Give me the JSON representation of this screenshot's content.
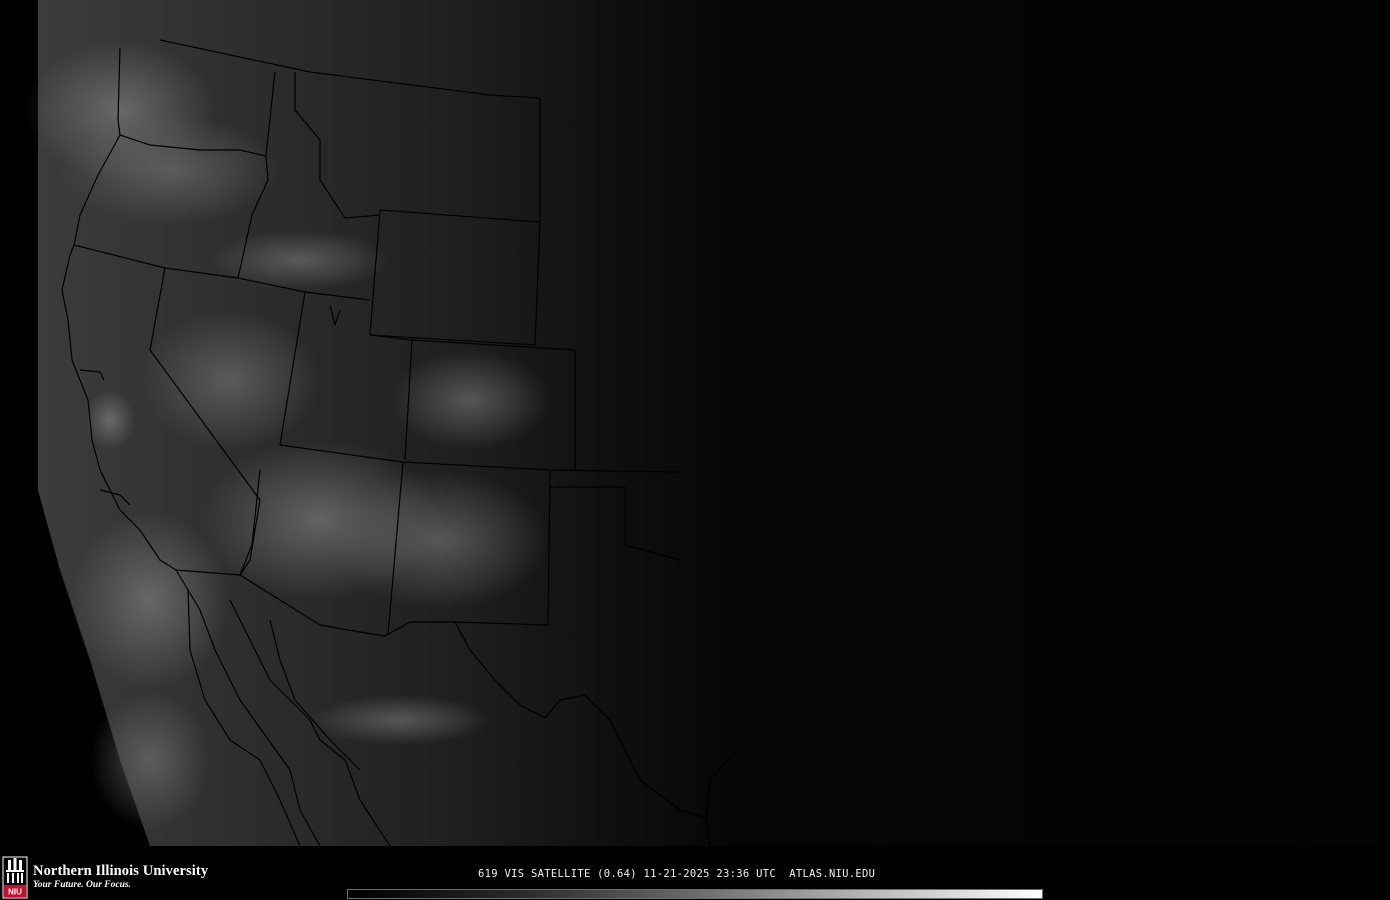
{
  "map": {
    "product": "visible satellite imagery",
    "region": "western and central United States",
    "colors": {
      "background": "#000000",
      "boundary_line": "#000000",
      "imagery_bright": "#3a3a3a",
      "imagery_dark": "#050505"
    }
  },
  "footer": {
    "university_name": "Northern Illinois University",
    "tagline": "Your Future. Our Focus.",
    "logo_letters": "NIU",
    "caption": "619 VIS SATELLITE (0.64) 11-21-2025 23:36 UTC  ATLAS.NIU.EDU",
    "colorbar": {
      "description": "grayscale brightness scale",
      "low_color": "#000000",
      "high_color": "#ffffff"
    },
    "colors": {
      "text": "#ffffff",
      "logo_red": "#c8102e"
    }
  }
}
